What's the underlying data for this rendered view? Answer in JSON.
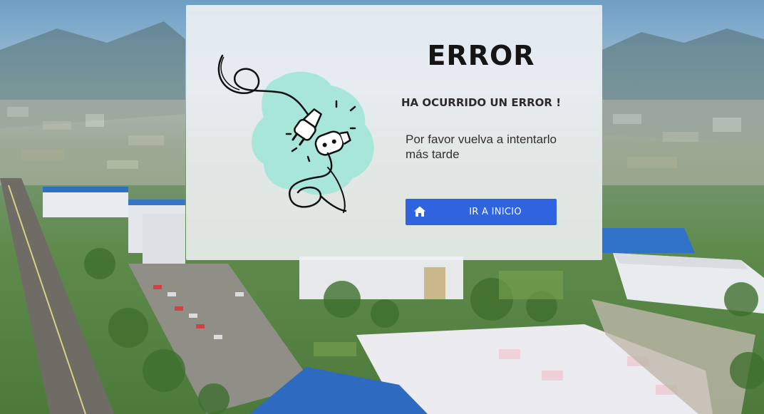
{
  "error": {
    "title": "ERROR",
    "subtitle": "HA OCURRIDO UN ERROR !",
    "message": "Por favor vuelva a intentarlo más tarde"
  },
  "actions": {
    "home_button_label": "IR A INICIO",
    "home_button_icon": "home-icon"
  },
  "illustration": {
    "icon": "unplugged-cable-icon",
    "blob_color": "#a8e6d9"
  },
  "colors": {
    "accent": "#2f63e0",
    "card_bg": "#f0f2f5"
  },
  "background": {
    "icon": "campus-aerial-photo"
  }
}
